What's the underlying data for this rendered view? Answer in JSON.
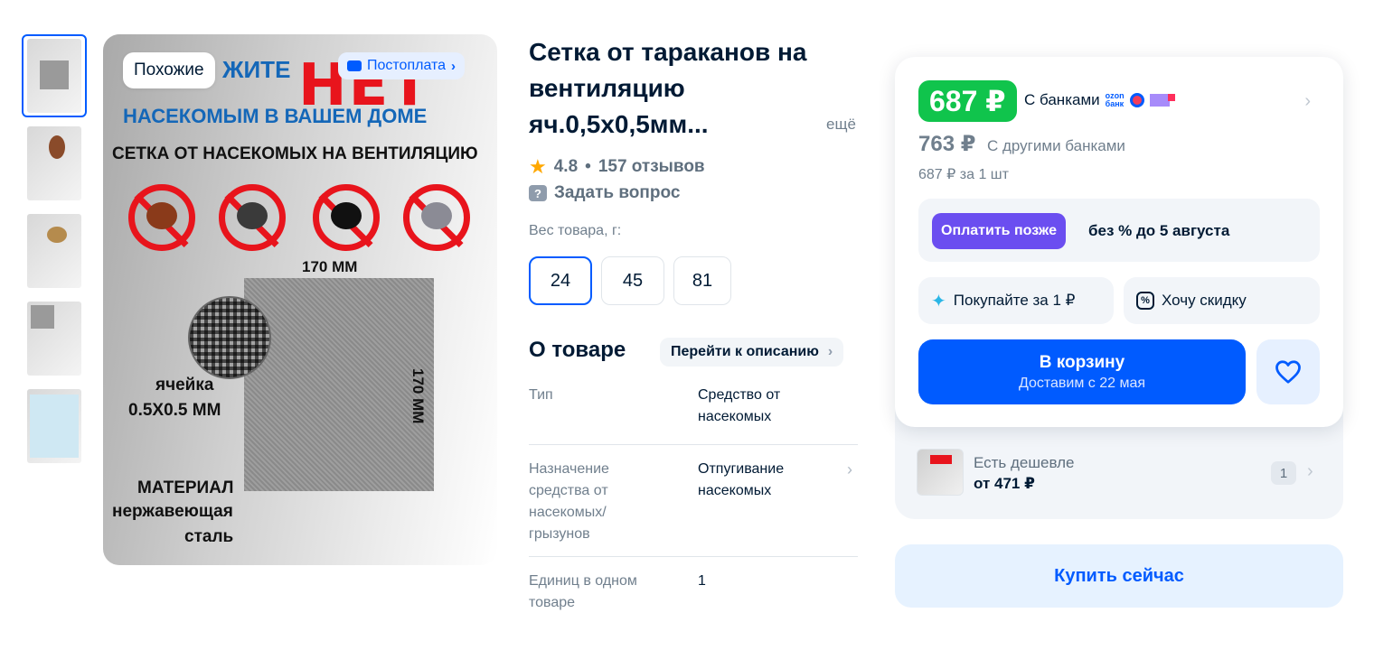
{
  "gallery": {
    "thumbnails": [
      "thumb-1",
      "thumb-2",
      "thumb-3",
      "thumb-4",
      "thumb-5"
    ],
    "similar_label": "Похожие",
    "postpay_label": "Постоплата",
    "image_text": {
      "headline_a": "ЖИТЕ",
      "headline_red": "НЕТ",
      "line2": "НАСЕКОМЫМ В ВАШЕМ ДОМЕ",
      "line3": "СЕТКА ОТ НАСЕКОМЫХ НА ВЕНТИЛЯЦИЮ",
      "size_h": "170 ММ",
      "size_v": "170 ММ",
      "cell_1": "ячейка",
      "cell_2": "0.5X0.5 ММ",
      "material_1": "МАТЕРИАЛ",
      "material_2": "нержавеющая",
      "material_3": "сталь"
    }
  },
  "product": {
    "title": "Сетка от тараканов на вентиляцию яч.0,5х0,5мм...",
    "more_link": "ещё",
    "rating": "4.8",
    "reviews": "157 отзывов",
    "rating_sep": "•",
    "ask_label": "Задать вопрос",
    "weight_label": "Вес товара, г:",
    "weights": [
      "24",
      "45",
      "81"
    ],
    "selected_weight": "24"
  },
  "about": {
    "heading": "О товаре",
    "to_description": "Перейти к описанию",
    "specs": [
      {
        "key": "Тип",
        "value": "Средство от насекомых"
      },
      {
        "key": "Назначение средства от насекомых/ грызунов",
        "value": "Отпугивание насекомых"
      },
      {
        "key": "Единиц в одном товаре",
        "value": "1"
      }
    ]
  },
  "buy_card": {
    "price": "687 ₽",
    "with_banks": "С банками",
    "ozon_bank_logo_top": "ozon",
    "ozon_bank_logo_bottom": "банк",
    "old_price": "763 ₽",
    "other_banks": "С другими банками",
    "per_unit": "687 ₽ за 1 шт",
    "bnpl_button": "Оплатить позже",
    "bnpl_text": "без % до 5 августа",
    "buy_for_1": "Покупайте за 1 ₽",
    "want_discount": "Хочу скидку",
    "cart_title": "В корзину",
    "cart_subtitle": "Доставим с 22 мая",
    "cheaper_title": "Есть дешевле",
    "cheaper_price": "от 471 ₽",
    "cheaper_count": "1",
    "buy_now": "Купить сейчас",
    "colors": {
      "price_badge": "#10c44c",
      "accent": "#005bff",
      "bnpl": "#6b4ef0"
    }
  }
}
